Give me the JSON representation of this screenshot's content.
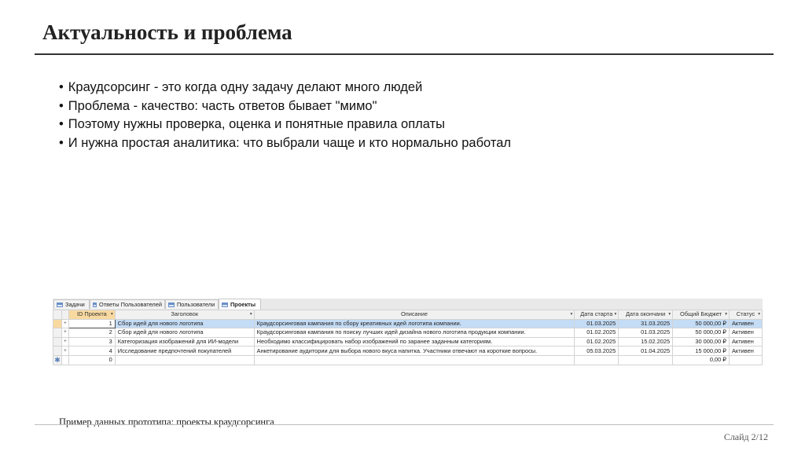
{
  "slide": {
    "title": "Актуальность и проблема",
    "bullets": [
      "Краудсорсинг - это когда одну задачу делают много людей",
      "Проблема - качество: часть ответов бывает \"мимо\"",
      "Поэтому нужны проверка, оценка и понятные правила оплаты",
      "И нужна простая аналитика: что выбрали чаще и кто нормально работал"
    ],
    "caption": "Пример данных прототипа: проекты краудсорсинга",
    "slide_number": "Слайд 2/12"
  },
  "access": {
    "tabs": [
      "Задачи",
      "Ответы Пользователей",
      "Пользователи",
      "Проекты"
    ],
    "columns": [
      "ID Проекта",
      "Заголовок",
      "Описание",
      "Дата старта",
      "Дата окончани",
      "Общий Бюджет",
      "Статус"
    ],
    "sort_glyph": "▾",
    "expand_glyph": "+",
    "new_record_glyph": "✱",
    "rows": [
      {
        "id": "1",
        "title": "Сбор идей для нового логотипа",
        "desc": "Краудсорсинговая кампания по сбору креативных идей логотипа компании.",
        "start": "01.03.2025",
        "end": "31.03.2025",
        "budget": "50 000,00 ₽",
        "status": "Активен"
      },
      {
        "id": "2",
        "title": "Сбор идей для нового логотипа",
        "desc": "Краудсорсинговая кампания по поиску лучших идей дизайна нового логотипа продукции компании.",
        "start": "01.02.2025",
        "end": "01.03.2025",
        "budget": "50 000,00 ₽",
        "status": "Активен"
      },
      {
        "id": "3",
        "title": "Категоризация изображений для ИИ-модели",
        "desc": "Необходимо классифицировать набор изображений по заранее заданным категориям.",
        "start": "01.02.2025",
        "end": "15.02.2025",
        "budget": "30 000,00 ₽",
        "status": "Активен"
      },
      {
        "id": "4",
        "title": "Исследование предпочтений покупателей",
        "desc": "Анкетирование аудитории для выбора нового вкуса напитка. Участники отвечают на короткие вопросы.",
        "start": "05.03.2025",
        "end": "01.04.2025",
        "budget": "15 000,00 ₽",
        "status": "Активен"
      }
    ],
    "new_row": {
      "id": "0",
      "budget": "0,00 ₽"
    }
  }
}
